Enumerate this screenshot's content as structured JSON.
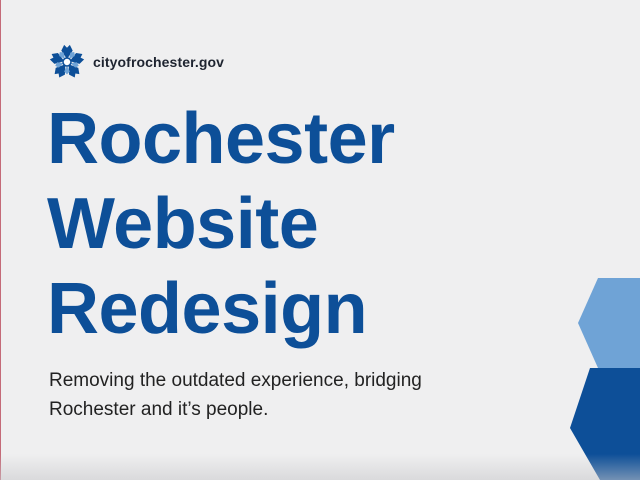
{
  "brand": {
    "logo_icon": "rochester-flower-logo-icon",
    "site_name": "cityofrochester.gov"
  },
  "headline": {
    "line1": "Rochester",
    "line2": "Website",
    "line3": "Redesign"
  },
  "tagline": {
    "line1": "Removing the outdated experience, bridging",
    "line2": "Rochester and it’s people."
  },
  "colors": {
    "primary_blue": "#0d4f98",
    "light_blue": "#6fa3d6",
    "background": "#efeff0",
    "text_dark": "#222222"
  }
}
